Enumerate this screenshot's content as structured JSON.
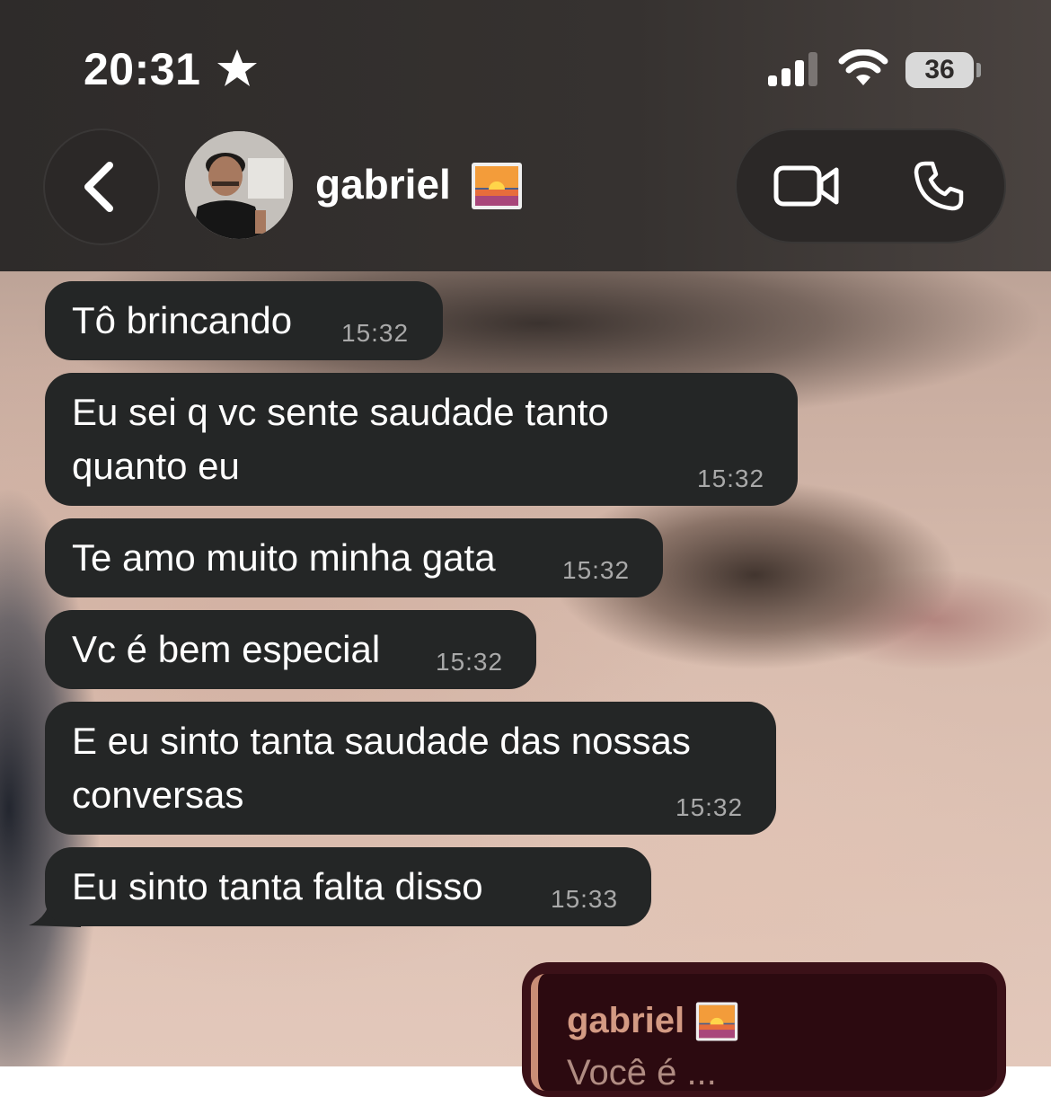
{
  "status_bar": {
    "time": "20:31",
    "battery": "36",
    "icons": [
      "star-icon",
      "cellular-signal-icon",
      "wifi-icon",
      "battery-icon"
    ]
  },
  "header": {
    "contact_name": "gabriel",
    "name_emoji": "sunrise-icon",
    "back_icon": "chevron-left-icon",
    "video_icon": "video-camera-icon",
    "call_icon": "phone-icon"
  },
  "messages": [
    {
      "text_lines": [
        "Tô brincando"
      ],
      "time": "15:32"
    },
    {
      "text_lines": [
        "Eu sei q vc sente saudade tanto",
        "quanto eu"
      ],
      "time": "15:32"
    },
    {
      "text_lines": [
        "Te amo muito minha gata"
      ],
      "time": "15:32"
    },
    {
      "text_lines": [
        "Vc é bem especial"
      ],
      "time": "15:32"
    },
    {
      "text_lines": [
        "E eu sinto tanta saudade das nossas",
        "conversas"
      ],
      "time": "15:32"
    },
    {
      "text_lines": [
        "Eu sinto tanta falta disso"
      ],
      "time": "15:33"
    }
  ],
  "reply": {
    "quoted_sender": "gabriel",
    "quoted_snippet": "Você é ...",
    "colors": {
      "bubble": "#3b1118",
      "quote_bar": "#c98d76",
      "sender": "#d39a83"
    }
  },
  "colors": {
    "incoming_bubble": "#242626",
    "header_bg": "#2e2b2a",
    "timestamp": "#a9a9a9"
  }
}
